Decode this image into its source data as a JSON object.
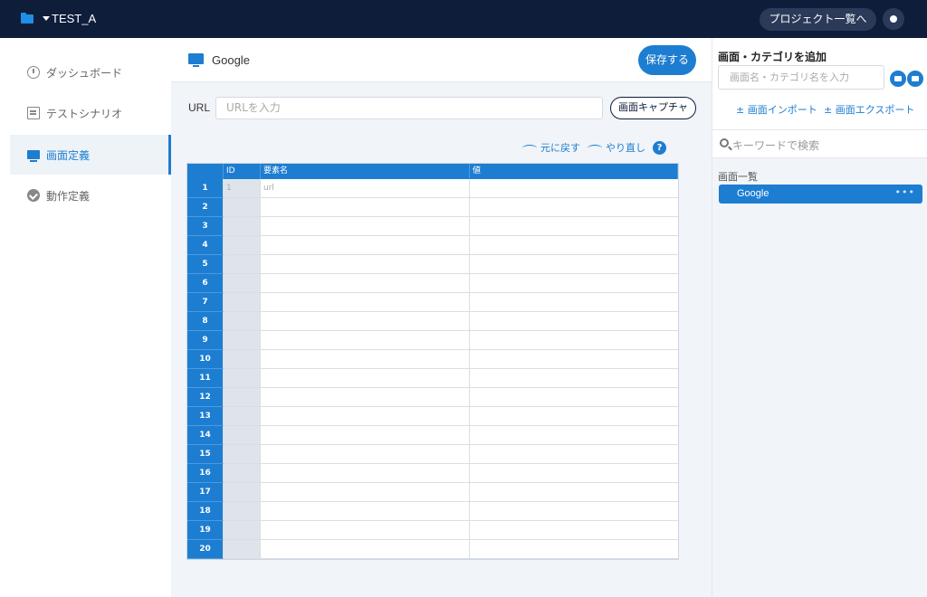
{
  "topbar": {
    "project_name": "TEST_A",
    "project_list_label": "プロジェクト一覧へ"
  },
  "sidebar": {
    "items": [
      {
        "label": "ダッシュボード",
        "icon": "clock-icon",
        "active": false
      },
      {
        "label": "テストシナリオ",
        "icon": "document-icon",
        "active": false
      },
      {
        "label": "画面定義",
        "icon": "monitor-icon",
        "active": true
      },
      {
        "label": "動作定義",
        "icon": "check-circle-icon",
        "active": false
      }
    ]
  },
  "screen": {
    "name": "Google",
    "save_label": "保存する",
    "url_label": "URL",
    "url_placeholder": "URLを入力",
    "capture_label": "画面キャプチャ",
    "undo_label": "元に戻す",
    "redo_label": "やり直し",
    "help_label": "?"
  },
  "grid": {
    "headers": [
      "",
      "ID",
      "要素名",
      "値"
    ],
    "rows": [
      {
        "num": "1",
        "id": "1",
        "name": "url",
        "value": ""
      },
      {
        "num": "2",
        "id": "",
        "name": "",
        "value": ""
      },
      {
        "num": "3",
        "id": "",
        "name": "",
        "value": ""
      },
      {
        "num": "4",
        "id": "",
        "name": "",
        "value": ""
      },
      {
        "num": "5",
        "id": "",
        "name": "",
        "value": ""
      },
      {
        "num": "6",
        "id": "",
        "name": "",
        "value": ""
      },
      {
        "num": "7",
        "id": "",
        "name": "",
        "value": ""
      },
      {
        "num": "8",
        "id": "",
        "name": "",
        "value": ""
      },
      {
        "num": "9",
        "id": "",
        "name": "",
        "value": ""
      },
      {
        "num": "10",
        "id": "",
        "name": "",
        "value": ""
      },
      {
        "num": "11",
        "id": "",
        "name": "",
        "value": ""
      },
      {
        "num": "12",
        "id": "",
        "name": "",
        "value": ""
      },
      {
        "num": "13",
        "id": "",
        "name": "",
        "value": ""
      },
      {
        "num": "14",
        "id": "",
        "name": "",
        "value": ""
      },
      {
        "num": "15",
        "id": "",
        "name": "",
        "value": ""
      },
      {
        "num": "16",
        "id": "",
        "name": "",
        "value": ""
      },
      {
        "num": "17",
        "id": "",
        "name": "",
        "value": ""
      },
      {
        "num": "18",
        "id": "",
        "name": "",
        "value": ""
      },
      {
        "num": "19",
        "id": "",
        "name": "",
        "value": ""
      },
      {
        "num": "20",
        "id": "",
        "name": "",
        "value": ""
      }
    ]
  },
  "right_panel": {
    "add_title": "画面・カテゴリを追加",
    "add_placeholder": "画面名・カテゴリ名を入力",
    "import_label": "± 画面インポート",
    "export_label": "± 画面エクスポート",
    "search_placeholder": "キーワードで検索",
    "list_title": "画面一覧",
    "list_items": [
      {
        "label": "Google",
        "more": "•••"
      }
    ]
  },
  "colors": {
    "topbar": "#0e1d3a",
    "accent": "#1d7dd1",
    "background": "#f1f4f8"
  }
}
